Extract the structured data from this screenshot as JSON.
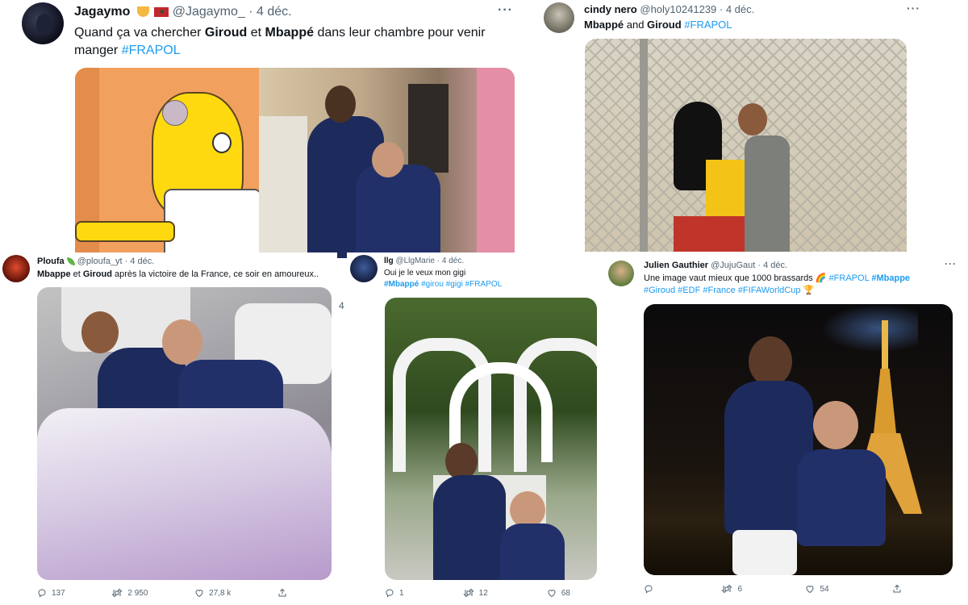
{
  "tweets": [
    {
      "name": "Jagaymo",
      "handle": "@Jagaymo_",
      "sep": " · ",
      "date": "4 déc.",
      "text": [
        {
          "t": "Quand ça va chercher ",
          "s": "plain"
        },
        {
          "t": "Giroud",
          "s": "bold"
        },
        {
          "t": " et ",
          "s": "plain"
        },
        {
          "t": "Mbappé",
          "s": "bold"
        },
        {
          "t": " dans leur chambre pour venir manger ",
          "s": "plain"
        },
        {
          "t": "#FRAPOL",
          "s": "tag"
        }
      ],
      "media_alt": "Homer Simpson peeking at two French players embracing in a hotel room",
      "more_label": "···"
    },
    {
      "name": "cindy nero",
      "handle": "@holy10241239",
      "sep": " · ",
      "date": "4 déc.",
      "text": [
        {
          "t": "Mbappé",
          "s": "bold"
        },
        {
          "t": " and ",
          "s": "plain"
        },
        {
          "t": "Giroud",
          "s": "bold"
        },
        {
          "t": " ",
          "s": "plain"
        },
        {
          "t": "#FRAPOL",
          "s": "tag"
        }
      ],
      "media_alt": "Couple kissing against a chain-link fence",
      "more_label": "···"
    },
    {
      "name": "Ploufa",
      "handle": "@ploufa_yt",
      "sep": " · ",
      "date": "4 déc.",
      "text": [
        {
          "t": "Mbappe",
          "s": "bold"
        },
        {
          "t": " et ",
          "s": "plain"
        },
        {
          "t": "Giroud",
          "s": "bold"
        },
        {
          "t": " après la victoire de la France, ce soir en amoureux..",
          "s": "plain"
        }
      ],
      "replies": "137",
      "retweets": "2 950",
      "likes": "27,8 k",
      "media_alt": "Two players embracing in bed"
    },
    {
      "name": "llg",
      "handle": "@LlgMarie",
      "sep": " · ",
      "date": "4 déc.",
      "text": [
        {
          "t": "Oui je le veux mon gigi",
          "s": "plain"
        },
        {
          "t": "\n",
          "s": "br"
        },
        {
          "t": "#Mbappé",
          "s": "tagbold"
        },
        {
          "t": " ",
          "s": "plain"
        },
        {
          "t": "#girou",
          "s": "tag"
        },
        {
          "t": " ",
          "s": "plain"
        },
        {
          "t": "#gigi",
          "s": "tag"
        },
        {
          "t": " ",
          "s": "plain"
        },
        {
          "t": "#FRAPOL",
          "s": "tag"
        }
      ],
      "replies": "1",
      "retweets": "12",
      "likes": "68",
      "media_alt": "Two players embracing in front of a white flower wedding arch"
    },
    {
      "name": "Julien Gauthier",
      "handle": "@JujuGaut",
      "sep": " · ",
      "date": "4 déc.",
      "text": [
        {
          "t": "Une image vaut mieux que 1000 brassards ",
          "s": "plain"
        },
        {
          "t": "🌈",
          "s": "emoji"
        },
        {
          "t": " ",
          "s": "plain"
        },
        {
          "t": "#FRAPOL",
          "s": "tag"
        },
        {
          "t": " ",
          "s": "plain"
        },
        {
          "t": "#Mbappe",
          "s": "tagbold"
        },
        {
          "t": "\n",
          "s": "br"
        },
        {
          "t": "#Giroud",
          "s": "tag"
        },
        {
          "t": " ",
          "s": "plain"
        },
        {
          "t": "#EDF",
          "s": "tag"
        },
        {
          "t": " ",
          "s": "plain"
        },
        {
          "t": "#France",
          "s": "tag"
        },
        {
          "t": " ",
          "s": "plain"
        },
        {
          "t": "#FIFAWorldCup",
          "s": "tag"
        },
        {
          "t": " ",
          "s": "plain"
        },
        {
          "t": "🏆",
          "s": "emoji"
        }
      ],
      "replies": "",
      "retweets": "6",
      "likes": "54",
      "more_label": "···",
      "media_alt": "Two players embracing in front of the Eiffel Tower at night"
    }
  ],
  "fragments": {
    "stray_count": "4"
  },
  "colors": {
    "accent": "#1d9bf0",
    "text": "#0f1419",
    "muted": "#536471"
  }
}
